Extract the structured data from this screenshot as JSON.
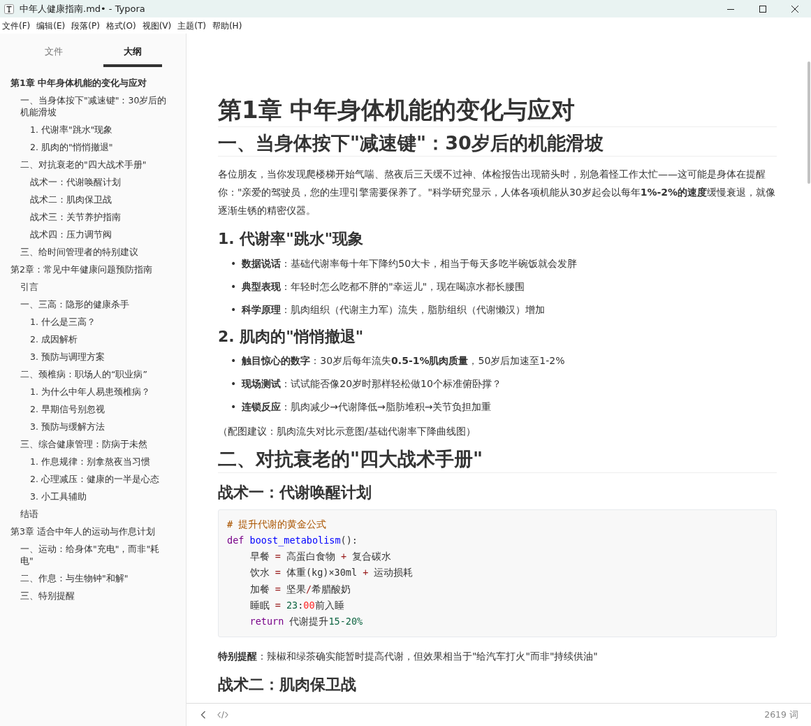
{
  "window": {
    "title": "中年人健康指南.md• - Typora"
  },
  "menu": [
    "文件(F)",
    "编辑(E)",
    "段落(P)",
    "格式(O)",
    "视图(V)",
    "主题(T)",
    "帮助(H)"
  ],
  "sidebar_tabs": [
    {
      "label": "文件",
      "selected": false
    },
    {
      "label": "大纲",
      "selected": true
    }
  ],
  "outline": [
    {
      "label": "第1章 中年身体机能的变化与应对",
      "selected": true,
      "children": [
        {
          "label": "一、当身体按下\"减速键\"：30岁后的机能滑坡",
          "children": [
            {
              "label": "1. 代谢率\"跳水\"现象"
            },
            {
              "label": "2. 肌肉的\"悄悄撤退\""
            }
          ]
        },
        {
          "label": "二、对抗衰老的\"四大战术手册\"",
          "children": [
            {
              "label": "战术一：代谢唤醒计划"
            },
            {
              "label": "战术二：肌肉保卫战"
            },
            {
              "label": "战术三：关节养护指南"
            },
            {
              "label": "战术四：压力调节阀"
            }
          ]
        },
        {
          "label": "三、给时间管理者的特别建议"
        }
      ]
    },
    {
      "label": "第2章：常见中年健康问题预防指南",
      "selected": false,
      "children": [
        {
          "label": "引言"
        },
        {
          "label": "一、三高：隐形的健康杀手",
          "children": [
            {
              "label": "1. 什么是三高？"
            },
            {
              "label": "2. 成因解析"
            },
            {
              "label": "3. 预防与调理方案"
            }
          ]
        },
        {
          "label": "二、颈椎病：职场人的“职业病”",
          "children": [
            {
              "label": "1. 为什么中年人易患颈椎病？"
            },
            {
              "label": "2. 早期信号别忽视"
            },
            {
              "label": "3. 预防与缓解方法"
            }
          ]
        },
        {
          "label": "三、综合健康管理：防病于未然",
          "children": [
            {
              "label": "1. 作息规律：别拿熬夜当习惯"
            },
            {
              "label": "2. 心理减压：健康的一半是心态"
            },
            {
              "label": "3. 小工具辅助"
            }
          ]
        },
        {
          "label": "结语"
        }
      ]
    },
    {
      "label": "第3章 适合中年人的运动与作息计划",
      "selected": false,
      "children": [
        {
          "label": "一、运动：给身体\"充电\"，而非\"耗电\""
        },
        {
          "label": "二、作息：与生物钟\"和解\""
        },
        {
          "label": "三、特别提醒"
        }
      ]
    }
  ],
  "document": [
    {
      "kind": "h1",
      "text": "第1章 中年身体机能的变化与应对"
    },
    {
      "kind": "h2",
      "text": "一、当身体按下\"减速键\"：30岁后的机能滑坡"
    },
    {
      "kind": "p",
      "text": "各位朋友，当你发现爬楼梯开始气喘、熬夜后三天缓不过神、体检报告出现箭头时，别急着怪工作太忙——这可能是身体在提醒你：\"亲爱的驾驶员，您的生理引擎需要保养了。\"科学研究显示，人体各项机能从30岁起会以每年**1%-2%的速度**缓慢衰退，就像逐渐生锈的精密仪器。"
    },
    {
      "kind": "h3",
      "text": "1. 代谢率\"跳水\"现象"
    },
    {
      "kind": "ul",
      "marker": "•",
      "items": [
        "**数据说话**：基础代谢率每十年下降约50大卡，相当于每天多吃半碗饭就会发胖",
        "**典型表现**：年轻时怎么吃都不胖的\"幸运儿\"，现在喝凉水都长腰围",
        "**科学原理**：肌肉组织（代谢主力军）流失，脂肪组织（代谢懒汉）增加"
      ]
    },
    {
      "kind": "h3",
      "text": "2. 肌肉的\"悄悄撤退\""
    },
    {
      "kind": "ul",
      "marker": "•",
      "items": [
        "**触目惊心的数字**：30岁后每年流失**0.5-1%肌肉质量**，50岁后加速至1-2%",
        "**现场测试**：试试能否像20岁时那样轻松做10个标准俯卧撑？",
        "**连锁反应**：肌肉减少→代谢降低→脂肪堆积→关节负担加重"
      ]
    },
    {
      "kind": "p",
      "text": "（配图建议：肌肉流失对比示意图/基础代谢率下降曲线图）"
    },
    {
      "kind": "h2",
      "text": "二、对抗衰老的\"四大战术手册\""
    },
    {
      "kind": "h3",
      "text": "战术一：代谢唤醒计划"
    },
    {
      "kind": "code",
      "lines": [
        {
          "indent": false,
          "tokens": [
            {
              "kind": "comment",
              "text": "# 提升代谢的黄金公式"
            }
          ]
        },
        {
          "indent": false,
          "tokens": [
            {
              "kind": "keyword",
              "text": "def"
            },
            {
              "kind": "function",
              "text": " boost_metabolism"
            },
            {
              "kind": "plain",
              "text": "():"
            }
          ]
        },
        {
          "indent": true,
          "tokens": [
            {
              "kind": "plain",
              "text": "早餐 "
            },
            {
              "kind": "operator",
              "text": "="
            },
            {
              "kind": "plain",
              "text": " 高蛋白食物 "
            },
            {
              "kind": "operator",
              "text": "+"
            },
            {
              "kind": "plain",
              "text": " 复合碳水"
            }
          ]
        },
        {
          "indent": true,
          "tokens": [
            {
              "kind": "plain",
              "text": "饮水 "
            },
            {
              "kind": "operator",
              "text": "="
            },
            {
              "kind": "plain",
              "text": " 体重(kg)×30ml "
            },
            {
              "kind": "operator",
              "text": "+"
            },
            {
              "kind": "plain",
              "text": " 运动损耗"
            }
          ]
        },
        {
          "indent": true,
          "tokens": [
            {
              "kind": "plain",
              "text": "加餐 "
            },
            {
              "kind": "operator",
              "text": "="
            },
            {
              "kind": "plain",
              "text": " 坚果"
            },
            {
              "kind": "operator",
              "text": "/"
            },
            {
              "kind": "plain",
              "text": "希腊酸奶"
            }
          ]
        },
        {
          "indent": true,
          "tokens": [
            {
              "kind": "plain",
              "text": "睡眠 "
            },
            {
              "kind": "operator",
              "text": "="
            },
            {
              "kind": "number",
              "text": " 23"
            },
            {
              "kind": "plain",
              "text": ":"
            },
            {
              "kind": "literal",
              "text": "00"
            },
            {
              "kind": "plain",
              "text": "前入睡"
            }
          ]
        },
        {
          "indent": true,
          "tokens": [
            {
              "kind": "keyword",
              "text": "return"
            },
            {
              "kind": "plain",
              "text": " 代谢提升"
            },
            {
              "kind": "number",
              "text": "15-20%"
            }
          ]
        }
      ]
    },
    {
      "kind": "p",
      "text": "**特别提醒**：辣椒和绿茶确实能暂时提高代谢，但效果相当于\"给汽车打火\"而非\"持续供油\""
    },
    {
      "kind": "h3",
      "text": "战术二：肌肉保卫战"
    }
  ],
  "status_bar": {
    "word_count": "2619 词"
  }
}
